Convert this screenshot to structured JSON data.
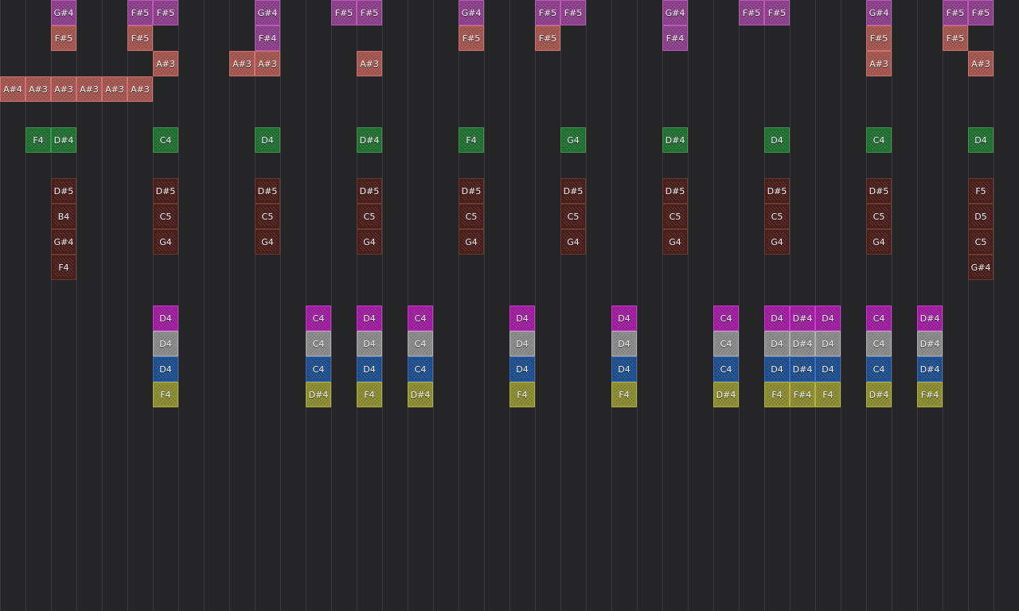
{
  "tracks": [
    {
      "name": "purple",
      "color": "#8e3f8c",
      "border": "#b060ae"
    },
    {
      "name": "salmon",
      "color": "#a55650",
      "border": "#c57670"
    },
    {
      "name": "green",
      "color": "#237033",
      "border": "#3c944d"
    },
    {
      "name": "maroon",
      "color": "#4a1e1a",
      "border": "#6a3a34"
    },
    {
      "name": "magenta",
      "color": "#a01fa0",
      "border": "#c440c4"
    },
    {
      "name": "gray",
      "color": "#8a8a8a",
      "border": "#b0b0b0"
    },
    {
      "name": "blue",
      "color": "#1f4f8f",
      "border": "#3d6fb2"
    },
    {
      "name": "olive",
      "color": "#8c8c30",
      "border": "#b0b050"
    }
  ],
  "notes": [
    {
      "col": 2,
      "row": 0,
      "label": "G#4",
      "track": 0
    },
    {
      "col": 5,
      "row": 0,
      "label": "F#5",
      "track": 0
    },
    {
      "col": 6,
      "row": 0,
      "label": "F#5",
      "track": 0
    },
    {
      "col": 10,
      "row": 0,
      "label": "G#4",
      "track": 0
    },
    {
      "col": 13,
      "row": 0,
      "label": "F#5",
      "track": 0
    },
    {
      "col": 14,
      "row": 0,
      "label": "F#5",
      "track": 0
    },
    {
      "col": 18,
      "row": 0,
      "label": "G#4",
      "track": 0
    },
    {
      "col": 21,
      "row": 0,
      "label": "F#5",
      "track": 0
    },
    {
      "col": 22,
      "row": 0,
      "label": "F#5",
      "track": 0
    },
    {
      "col": 26,
      "row": 0,
      "label": "G#4",
      "track": 0
    },
    {
      "col": 29,
      "row": 0,
      "label": "F#5",
      "track": 0
    },
    {
      "col": 30,
      "row": 0,
      "label": "F#5",
      "track": 0
    },
    {
      "col": 34,
      "row": 0,
      "label": "G#4",
      "track": 0
    },
    {
      "col": 37,
      "row": 0,
      "label": "F#5",
      "track": 0
    },
    {
      "col": 38,
      "row": 0,
      "label": "F#5",
      "track": 0
    },
    {
      "col": 2,
      "row": 1,
      "label": "F#5",
      "track": 1
    },
    {
      "col": 5,
      "row": 1,
      "label": "F#5",
      "track": 1
    },
    {
      "col": 10,
      "row": 1,
      "label": "F#4",
      "track": 0
    },
    {
      "col": 18,
      "row": 1,
      "label": "F#5",
      "track": 1
    },
    {
      "col": 21,
      "row": 1,
      "label": "F#5",
      "track": 1
    },
    {
      "col": 26,
      "row": 1,
      "label": "F#4",
      "track": 0
    },
    {
      "col": 34,
      "row": 1,
      "label": "F#5",
      "track": 1
    },
    {
      "col": 37,
      "row": 1,
      "label": "F#5",
      "track": 1
    },
    {
      "col": 6,
      "row": 2,
      "label": "A#3",
      "track": 1
    },
    {
      "col": 9,
      "row": 2,
      "label": "A#3",
      "track": 1
    },
    {
      "col": 10,
      "row": 2,
      "label": "A#3",
      "track": 1
    },
    {
      "col": 14,
      "row": 2,
      "label": "A#3",
      "track": 1
    },
    {
      "col": 34,
      "row": 2,
      "label": "A#3",
      "track": 1
    },
    {
      "col": 38,
      "row": 2,
      "label": "A#3",
      "track": 1
    },
    {
      "col": 0,
      "row": 3,
      "label": "A#4",
      "track": 1
    },
    {
      "col": 1,
      "row": 3,
      "label": "A#3",
      "track": 1
    },
    {
      "col": 2,
      "row": 3,
      "label": "A#3",
      "track": 1
    },
    {
      "col": 3,
      "row": 3,
      "label": "A#3",
      "track": 1
    },
    {
      "col": 4,
      "row": 3,
      "label": "A#3",
      "track": 1
    },
    {
      "col": 5,
      "row": 3,
      "label": "A#3",
      "track": 1
    },
    {
      "col": 1,
      "row": 5,
      "label": "F4",
      "track": 2
    },
    {
      "col": 2,
      "row": 5,
      "label": "D#4",
      "track": 2
    },
    {
      "col": 6,
      "row": 5,
      "label": "C4",
      "track": 2
    },
    {
      "col": 10,
      "row": 5,
      "label": "D4",
      "track": 2
    },
    {
      "col": 14,
      "row": 5,
      "label": "D#4",
      "track": 2
    },
    {
      "col": 18,
      "row": 5,
      "label": "F4",
      "track": 2
    },
    {
      "col": 22,
      "row": 5,
      "label": "G4",
      "track": 2
    },
    {
      "col": 26,
      "row": 5,
      "label": "D#4",
      "track": 2
    },
    {
      "col": 30,
      "row": 5,
      "label": "D4",
      "track": 2
    },
    {
      "col": 34,
      "row": 5,
      "label": "C4",
      "track": 2
    },
    {
      "col": 38,
      "row": 5,
      "label": "D4",
      "track": 2
    },
    {
      "col": 2,
      "row": 7,
      "label": "D#5",
      "track": 3
    },
    {
      "col": 6,
      "row": 7,
      "label": "D#5",
      "track": 3
    },
    {
      "col": 10,
      "row": 7,
      "label": "D#5",
      "track": 3
    },
    {
      "col": 14,
      "row": 7,
      "label": "D#5",
      "track": 3
    },
    {
      "col": 18,
      "row": 7,
      "label": "D#5",
      "track": 3
    },
    {
      "col": 22,
      "row": 7,
      "label": "D#5",
      "track": 3
    },
    {
      "col": 26,
      "row": 7,
      "label": "D#5",
      "track": 3
    },
    {
      "col": 30,
      "row": 7,
      "label": "D#5",
      "track": 3
    },
    {
      "col": 34,
      "row": 7,
      "label": "D#5",
      "track": 3
    },
    {
      "col": 38,
      "row": 7,
      "label": "F5",
      "track": 3
    },
    {
      "col": 2,
      "row": 8,
      "label": "B4",
      "track": 3
    },
    {
      "col": 6,
      "row": 8,
      "label": "C5",
      "track": 3
    },
    {
      "col": 10,
      "row": 8,
      "label": "C5",
      "track": 3
    },
    {
      "col": 14,
      "row": 8,
      "label": "C5",
      "track": 3
    },
    {
      "col": 18,
      "row": 8,
      "label": "C5",
      "track": 3
    },
    {
      "col": 22,
      "row": 8,
      "label": "C5",
      "track": 3
    },
    {
      "col": 26,
      "row": 8,
      "label": "C5",
      "track": 3
    },
    {
      "col": 30,
      "row": 8,
      "label": "C5",
      "track": 3
    },
    {
      "col": 34,
      "row": 8,
      "label": "C5",
      "track": 3
    },
    {
      "col": 38,
      "row": 8,
      "label": "D5",
      "track": 3
    },
    {
      "col": 2,
      "row": 9,
      "label": "G#4",
      "track": 3
    },
    {
      "col": 6,
      "row": 9,
      "label": "G4",
      "track": 3
    },
    {
      "col": 10,
      "row": 9,
      "label": "G4",
      "track": 3
    },
    {
      "col": 14,
      "row": 9,
      "label": "G4",
      "track": 3
    },
    {
      "col": 18,
      "row": 9,
      "label": "G4",
      "track": 3
    },
    {
      "col": 22,
      "row": 9,
      "label": "G4",
      "track": 3
    },
    {
      "col": 26,
      "row": 9,
      "label": "G4",
      "track": 3
    },
    {
      "col": 30,
      "row": 9,
      "label": "G4",
      "track": 3
    },
    {
      "col": 34,
      "row": 9,
      "label": "G4",
      "track": 3
    },
    {
      "col": 38,
      "row": 9,
      "label": "C5",
      "track": 3
    },
    {
      "col": 2,
      "row": 10,
      "label": "F4",
      "track": 3
    },
    {
      "col": 38,
      "row": 10,
      "label": "G#4",
      "track": 3
    },
    {
      "col": 6,
      "row": 12,
      "label": "D4",
      "track": 4
    },
    {
      "col": 12,
      "row": 12,
      "label": "C4",
      "track": 4
    },
    {
      "col": 14,
      "row": 12,
      "label": "D4",
      "track": 4
    },
    {
      "col": 16,
      "row": 12,
      "label": "C4",
      "track": 4
    },
    {
      "col": 20,
      "row": 12,
      "label": "D4",
      "track": 4
    },
    {
      "col": 24,
      "row": 12,
      "label": "D4",
      "track": 4
    },
    {
      "col": 28,
      "row": 12,
      "label": "C4",
      "track": 4
    },
    {
      "col": 30,
      "row": 12,
      "label": "D4",
      "track": 4
    },
    {
      "col": 31,
      "row": 12,
      "label": "D#4",
      "track": 4
    },
    {
      "col": 32,
      "row": 12,
      "label": "D4",
      "track": 4
    },
    {
      "col": 34,
      "row": 12,
      "label": "C4",
      "track": 4
    },
    {
      "col": 36,
      "row": 12,
      "label": "D#4",
      "track": 4
    },
    {
      "col": 6,
      "row": 13,
      "label": "D4",
      "track": 5
    },
    {
      "col": 12,
      "row": 13,
      "label": "C4",
      "track": 5
    },
    {
      "col": 14,
      "row": 13,
      "label": "D4",
      "track": 5
    },
    {
      "col": 16,
      "row": 13,
      "label": "C4",
      "track": 5
    },
    {
      "col": 20,
      "row": 13,
      "label": "D4",
      "track": 5
    },
    {
      "col": 24,
      "row": 13,
      "label": "D4",
      "track": 5
    },
    {
      "col": 28,
      "row": 13,
      "label": "C4",
      "track": 5
    },
    {
      "col": 30,
      "row": 13,
      "label": "D4",
      "track": 5
    },
    {
      "col": 31,
      "row": 13,
      "label": "D#4",
      "track": 5
    },
    {
      "col": 32,
      "row": 13,
      "label": "D4",
      "track": 5
    },
    {
      "col": 34,
      "row": 13,
      "label": "C4",
      "track": 5
    },
    {
      "col": 36,
      "row": 13,
      "label": "D#4",
      "track": 5
    },
    {
      "col": 6,
      "row": 14,
      "label": "D4",
      "track": 6
    },
    {
      "col": 12,
      "row": 14,
      "label": "C4",
      "track": 6
    },
    {
      "col": 14,
      "row": 14,
      "label": "D4",
      "track": 6
    },
    {
      "col": 16,
      "row": 14,
      "label": "C4",
      "track": 6
    },
    {
      "col": 20,
      "row": 14,
      "label": "D4",
      "track": 6
    },
    {
      "col": 24,
      "row": 14,
      "label": "D4",
      "track": 6
    },
    {
      "col": 28,
      "row": 14,
      "label": "C4",
      "track": 6
    },
    {
      "col": 30,
      "row": 14,
      "label": "D4",
      "track": 6
    },
    {
      "col": 31,
      "row": 14,
      "label": "D#4",
      "track": 6
    },
    {
      "col": 32,
      "row": 14,
      "label": "D4",
      "track": 6
    },
    {
      "col": 34,
      "row": 14,
      "label": "C4",
      "track": 6
    },
    {
      "col": 36,
      "row": 14,
      "label": "D#4",
      "track": 6
    },
    {
      "col": 6,
      "row": 15,
      "label": "F4",
      "track": 7
    },
    {
      "col": 12,
      "row": 15,
      "label": "D#4",
      "track": 7
    },
    {
      "col": 14,
      "row": 15,
      "label": "F4",
      "track": 7
    },
    {
      "col": 16,
      "row": 15,
      "label": "D#4",
      "track": 7
    },
    {
      "col": 20,
      "row": 15,
      "label": "F4",
      "track": 7
    },
    {
      "col": 24,
      "row": 15,
      "label": "F4",
      "track": 7
    },
    {
      "col": 28,
      "row": 15,
      "label": "D#4",
      "track": 7
    },
    {
      "col": 30,
      "row": 15,
      "label": "F4",
      "track": 7
    },
    {
      "col": 31,
      "row": 15,
      "label": "F#4",
      "track": 7
    },
    {
      "col": 32,
      "row": 15,
      "label": "F4",
      "track": 7
    },
    {
      "col": 34,
      "row": 15,
      "label": "D#4",
      "track": 7
    },
    {
      "col": 36,
      "row": 15,
      "label": "F#4",
      "track": 7
    }
  ]
}
